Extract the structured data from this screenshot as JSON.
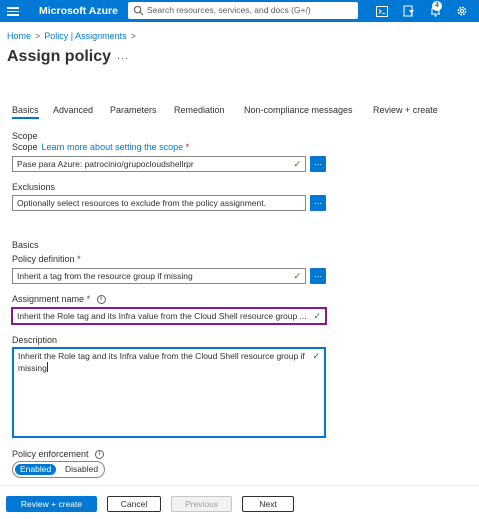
{
  "topbar": {
    "brand": "Microsoft Azure",
    "search_placeholder": "Search resources, services, and docs (G+/)",
    "notifications_count": "4",
    "icons": [
      "menu-icon",
      "search-icon",
      "cloud-shell-icon",
      "directory-filter-icon",
      "notifications-icon",
      "settings-icon"
    ],
    "accent_color": "#0078d4"
  },
  "breadcrumb": {
    "items": [
      "Home",
      "Policy | Assignments"
    ],
    "separator": ">"
  },
  "page": {
    "title": "Assign policy",
    "more": "..."
  },
  "tabs": [
    {
      "label": "Basics",
      "active": true
    },
    {
      "label": "Advanced"
    },
    {
      "label": "Parameters"
    },
    {
      "label": "Remediation"
    },
    {
      "label": "Non-compliance messages"
    },
    {
      "label": "Review + create"
    }
  ],
  "form": {
    "scope_section": "Scope",
    "scope_label": "Scope",
    "scope_link": "Learn more about setting the scope",
    "required_mark": "*",
    "scope_value": "Pase para Azure: patrocinio/grupocloudshellrpr",
    "exclusions_label": "Exclusions",
    "exclusions_value": "Optionally select resources to exclude from the policy assignment.",
    "basics_section": "Basics",
    "policy_definition_label": "Policy definition",
    "policy_definition_value": "Inherit a tag from the resource group if missing",
    "assignment_name_label": "Assignment name",
    "assignment_name_value": "Inherit the Role tag and its Infra value from the Cloud Shell resource group ...",
    "description_label": "Description",
    "description_value": "Inherit the Role tag and its Infra value from the Cloud Shell resource group if missing",
    "policy_enforcement_label": "Policy enforcement",
    "enforcement_options": [
      "Enabled",
      "Disabled"
    ],
    "enforcement_selected": "Enabled",
    "browse_label": "..."
  },
  "footer": {
    "review_create": "Review + create",
    "cancel": "Cancel",
    "previous": "Previous",
    "next": "Next"
  }
}
